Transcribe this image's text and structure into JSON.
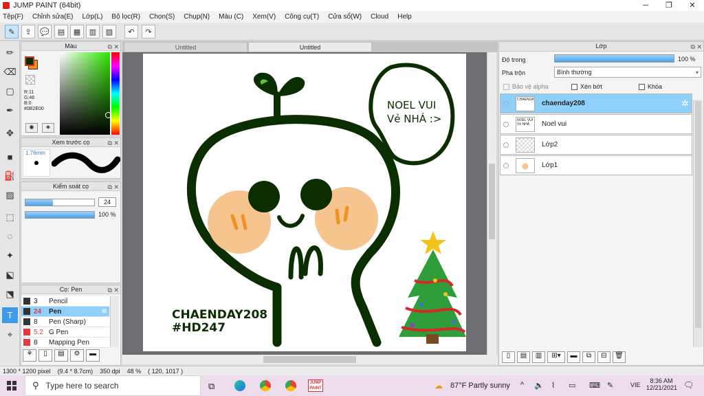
{
  "window": {
    "title": "JUMP PAINT (64bit)",
    "minimize": "─",
    "maximize": "❐",
    "close": "✕"
  },
  "menu": [
    "Tệp(F)",
    "Chỉnh sửa(E)",
    "Lớp(L)",
    "Bộ lọc(R)",
    "Chọn(S)",
    "Chụp(N)",
    "Màu (C)",
    "Xem(V)",
    "Công cụ(T)",
    "Cửa sổ(W)",
    "Cloud",
    "Help"
  ],
  "color_panel": {
    "title": "Màu",
    "r": "R:11",
    "g": "G:46",
    "b": "B:0",
    "hex": "#0B2E00",
    "fg_color": "#0b2e00",
    "bg_color": "#ff8c1a"
  },
  "brush_preview": {
    "title": "Xem trước cọ",
    "size": "1.76mm"
  },
  "brush_control": {
    "title": "Kiểm soát cọ",
    "size_value": "24",
    "opacity_value": "100 %",
    "size_fill": 0.4,
    "opacity_fill": 1.0
  },
  "brush_list": {
    "title": "Cọ: Pen",
    "items": [
      {
        "size": "3",
        "name": "Pencil",
        "color": "#333333"
      },
      {
        "size": "24",
        "name": "Pen",
        "color": "#333333"
      },
      {
        "size": "8",
        "name": "Pen (Sharp)",
        "color": "#333333"
      },
      {
        "size": "5.2",
        "name": "G Pen",
        "color": "#e23b3b"
      },
      {
        "size": "8",
        "name": "Mapping Pen",
        "color": "#e23b3b"
      }
    ]
  },
  "tabs": [
    "Untitled",
    "Untitled"
  ],
  "canvas": {
    "speech": {
      "line1": "NOEL VUI",
      "line2": "Vẻ NHÁ :>"
    },
    "signature": {
      "line1": "CHAENDAY208",
      "line2": "#HD247"
    }
  },
  "layer_panel": {
    "title": "Lớp",
    "opacity_label": "Độ trong",
    "opacity_value": "100 %",
    "opacity_fill": 1.0,
    "blend_label": "Pha trộn",
    "blend_value": "Bình thường",
    "protect_alpha": "Bảo vệ alpha",
    "clipping": "Xén bớt",
    "lock": "Khóa",
    "layers": [
      {
        "name": "chaenday208",
        "thumb": "CHAENDAY208"
      },
      {
        "name": "Noel vui",
        "thumb": "NOEL VUI Vẻ NHÁ"
      },
      {
        "name": "Lớp2",
        "thumb": ""
      },
      {
        "name": "Lớp1",
        "thumb": ""
      }
    ]
  },
  "status": {
    "dims": "1300 * 1200 pixel",
    "size": "(9.4 * 8.7cm)",
    "dpi": "350 dpi",
    "zoom": "48 %",
    "coord": "( 120, 1017 )"
  },
  "taskbar": {
    "search_placeholder": "Type here to search",
    "weather": "87°F  Partly sunny",
    "lang": "VIE",
    "time": "8:36 AM",
    "date": "12/21/2021"
  }
}
